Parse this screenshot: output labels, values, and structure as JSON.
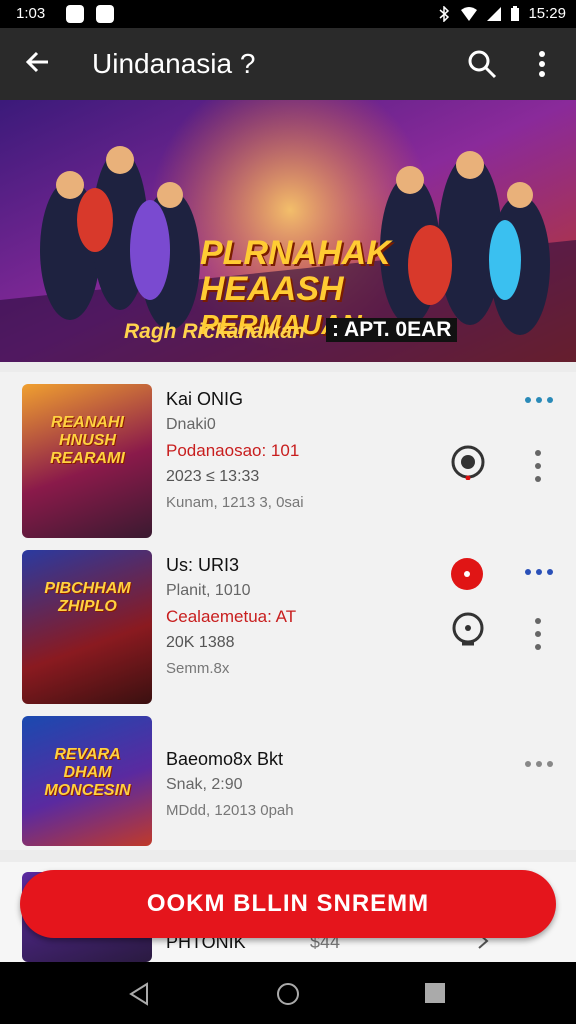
{
  "status_bar": {
    "time_left": "1:03",
    "time_right": "15:29"
  },
  "app_bar": {
    "title": "Uindanasia ?",
    "icons": [
      "back-arrow-icon",
      "search-icon",
      "more-vert-icon"
    ]
  },
  "banner": {
    "headline_1": "PLRNAHAK",
    "headline_2": "HEAASH",
    "headline_3": "PERMAUAN",
    "subtitle": "Ragh Rickanaikan",
    "badge": ": APT. 0EAR"
  },
  "items": [
    {
      "thumb_text": "REANAHI HNUSH REARAMI",
      "title": "Kai ONIG",
      "subtitle": "Dnaki0",
      "highlight": "Podanaosao: 101",
      "date": "2023 ≤ 13:33",
      "footer": "Kunam, 1213 3, 0sai"
    },
    {
      "thumb_text": "PIBCHHAM ZHIPLO",
      "title": "Us: URI3",
      "subtitle": "Planit, 1010",
      "highlight": "Cealaemetua: AT",
      "date": "20K 1388",
      "footer": "Semm.8x"
    },
    {
      "thumb_text": "REVARA DHAM MONCESIN",
      "title": "Baeomo8x Bkt",
      "subtitle": "Snak, 2:90",
      "footer": "MDdd, 12013 0pah"
    }
  ],
  "peek_item": {
    "title": "PHTONIK",
    "value": "$44"
  },
  "cta": {
    "label": "OOKM BLLIN SNREMM"
  },
  "colors": {
    "accent_red": "#e5151c",
    "app_bar": "#2a2a2a",
    "link_blue": "#2a8ab8"
  }
}
